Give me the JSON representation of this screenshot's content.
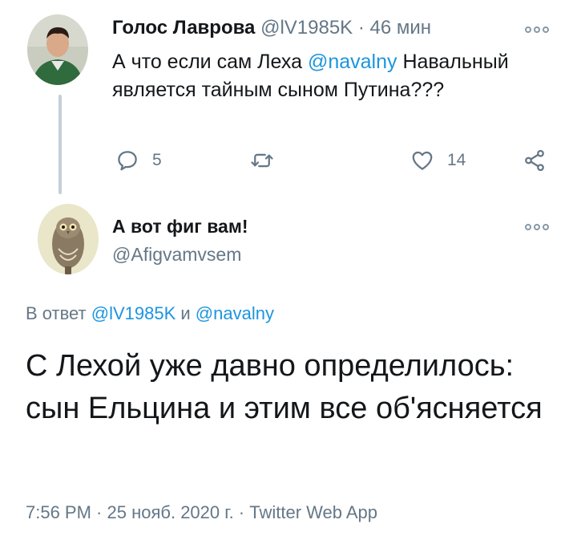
{
  "tweet1": {
    "author_name": "Голос Лаврова",
    "handle": "@lV1985K",
    "separator": "·",
    "time_ago": "46 мин",
    "text_before": "А что если сам Леха ",
    "mention": "@navalny",
    "text_after": " Навальный является тайным сыном Путина???",
    "reply_count": "5",
    "like_count": "14",
    "icons": [
      "more-icon",
      "reply-icon",
      "retweet-icon",
      "like-icon",
      "share-icon"
    ]
  },
  "tweet2": {
    "author_name": "А вот фиг вам!",
    "handle": "@Afigvamvsem",
    "reply_prefix": "В ответ ",
    "reply_mention1": "@lV1985K",
    "reply_and": " и ",
    "reply_mention2": "@navalny",
    "text": "С Лехой уже давно определилось: сын Ельцина и этим все об'ясняется",
    "footer": "7:56 PM · 25 нояб. 2020 г. · Twitter Web App"
  },
  "colors": {
    "text": "#14171a",
    "secondary": "#657786",
    "link": "#1b95e0",
    "thread_line": "#c4cfd6"
  }
}
